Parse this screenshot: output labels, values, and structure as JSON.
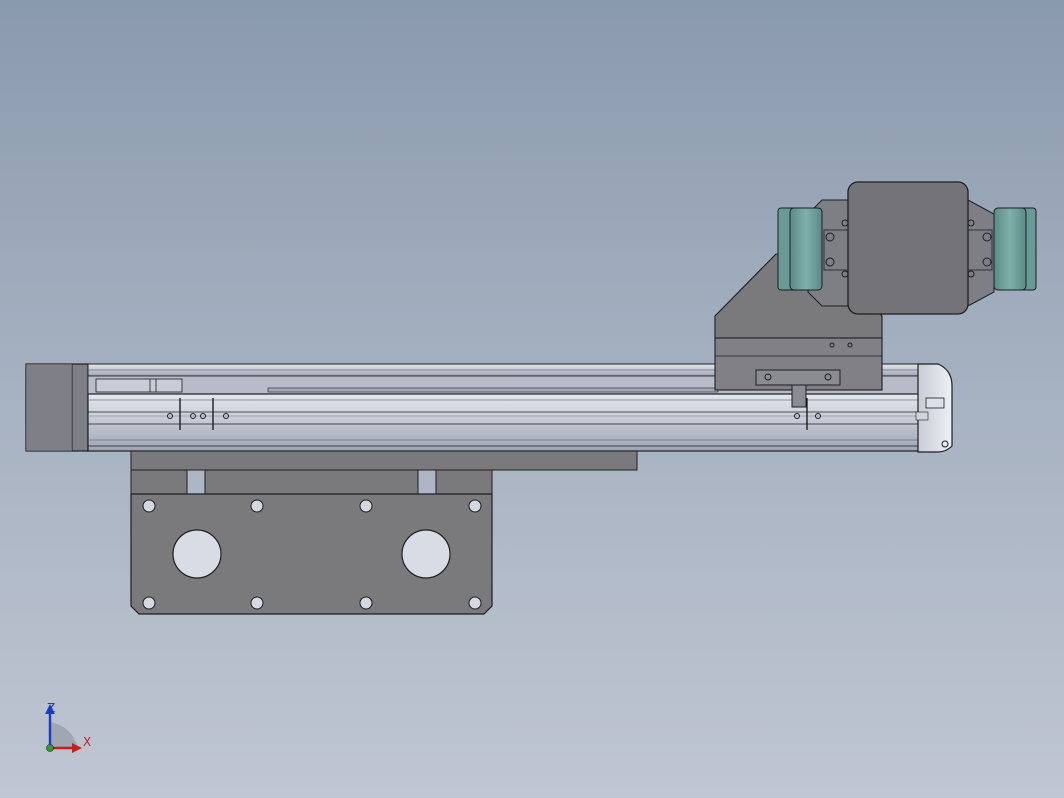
{
  "viewport": {
    "background_top": "#8a9aad",
    "background_bottom": "#c0c6d2"
  },
  "model": {
    "body_color": "#7a7a7c",
    "rail_color": "#c6cbd6",
    "rail_dark": "#9aa0ae",
    "gripper_pad_color": "#6e9e9a",
    "outline_color": "#1e1e22"
  },
  "triad": {
    "z_label": "Z",
    "x_label": "X",
    "z_color": "#1e3cc8",
    "x_color": "#c81e1e",
    "icons": [
      "axis-z-arrow-icon",
      "axis-x-arrow-icon",
      "axis-origin-icon"
    ]
  }
}
